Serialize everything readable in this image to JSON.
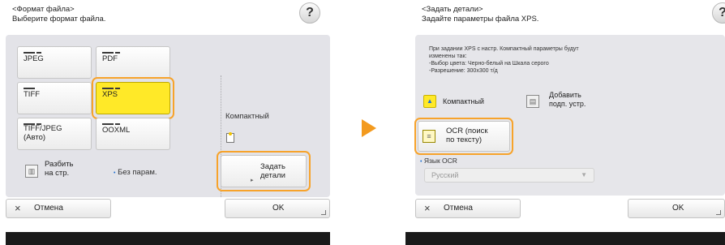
{
  "left": {
    "header_line1": "<Формат файла>",
    "header_line2": "Выберите формат файла.",
    "help": "?",
    "formats": {
      "jpeg": "JPEG",
      "pdf": "PDF",
      "tiff": "TIFF",
      "xps": "XPS",
      "tiff_jpeg_line1": "TIFF/JPEG",
      "tiff_jpeg_line2": "(Авто)",
      "ooxml": "OOXML"
    },
    "compact_label": "Компактный",
    "split_line1": "Разбить",
    "split_line2": "на стр.",
    "no_params": "Без парам.",
    "details_line1": "Задать",
    "details_line2": "детали",
    "cancel": "Отмена",
    "ok": "OK"
  },
  "right": {
    "header_line1": "<Задать детали>",
    "header_line2": "Задайте параметры файла XPS.",
    "help": "?",
    "desc_line1": "При задании XPS с настр. Компактный параметры будут",
    "desc_line2": "изменены так:",
    "desc_line3": "-Выбор цвета: Черно-белый на Шкала серого",
    "desc_line4": "-Разрешение: 300x300 т/д",
    "compact": "Компактный",
    "add_line1": "Добавить",
    "add_line2": "подп. устр.",
    "ocr_line1": "OCR (поиск",
    "ocr_line2": "по тексту)",
    "ocr_lang_label": "Язык OCR",
    "ocr_lang_value": "Русский",
    "cancel": "Отмена",
    "ok": "OK"
  },
  "colors": {
    "accent_orange": "#f39a1e",
    "selected_yellow": "#ffe928"
  }
}
